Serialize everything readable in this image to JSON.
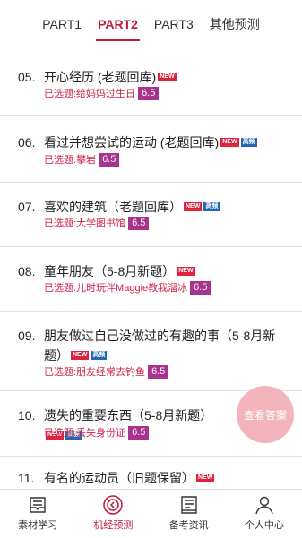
{
  "tabs": [
    "PART1",
    "PART2",
    "PART3",
    "其他预测"
  ],
  "items": [
    {
      "num": "05.",
      "title": "开心经历 (老题回库)",
      "new": true,
      "hot": false,
      "selected": "已选题:给妈妈过生日",
      "score": "6.5"
    },
    {
      "num": "06.",
      "title": "看过并想尝试的运动 (老题回库)",
      "new": true,
      "hot": true,
      "selected": "已选题:攀岩",
      "score": "6.5"
    },
    {
      "num": "07.",
      "title": "喜欢的建筑（老题回库）",
      "new": true,
      "hot": true,
      "selected": "已选题:大学图书馆",
      "score": "6.5"
    },
    {
      "num": "08.",
      "title": "童年朋友（5-8月新题）",
      "new": true,
      "hot": false,
      "selected": "已选题:儿时玩伴Maggie教我溜冰",
      "score": "6.5"
    },
    {
      "num": "09.",
      "title": "朋友做过自己没做过的有趣的事（5-8月新题）",
      "new": true,
      "hot": true,
      "selected": "已选题:朋友经常去钓鱼",
      "score": "6.5"
    },
    {
      "num": "10.",
      "title": "遗失的重要东西（5-8月新题）",
      "new": true,
      "hot": true,
      "selected": "已选题:丢失身份证",
      "score": "6.5"
    },
    {
      "num": "11.",
      "title": "有名的运动员（旧题保留）",
      "new": true,
      "hot": false,
      "selected": "",
      "score": ""
    }
  ],
  "badges": {
    "new": "NEW",
    "hot": "高频"
  },
  "fab": "查看答案",
  "nav": [
    {
      "label": "素材学习",
      "icon": "book-icon"
    },
    {
      "label": "机经预测",
      "icon": "target-icon"
    },
    {
      "label": "备考资讯",
      "icon": "news-icon"
    },
    {
      "label": "个人中心",
      "icon": "person-icon"
    }
  ],
  "colors": {
    "accent": "#c0183a",
    "score": "#a8338d",
    "new": "#e0223e",
    "hot": "#2366b5"
  }
}
